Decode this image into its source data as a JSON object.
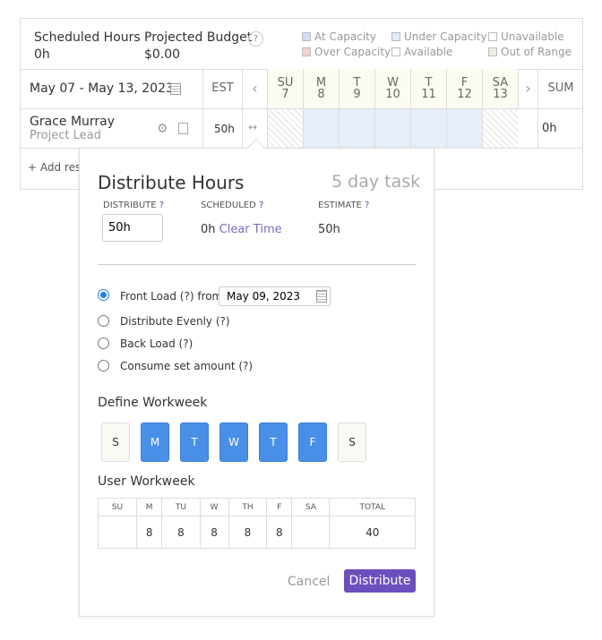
{
  "summary": {
    "scheduled_label": "Scheduled Hours",
    "scheduled_value": "0h",
    "budget_label": "Projected Budget",
    "budget_value": "$0.00",
    "help": "?"
  },
  "legend": [
    {
      "label": "At Capacity",
      "color": "#cfe0f7"
    },
    {
      "label": "Under Capacity",
      "color": "#e4ebfb"
    },
    {
      "label": "Unavailable",
      "color": "#ffffff"
    },
    {
      "label": "Over Capacity",
      "color": "#f4d3d0"
    },
    {
      "label": "Available",
      "color": "#ffffff"
    },
    {
      "label": "Out of Range",
      "color": "#eeeee6"
    }
  ],
  "header": {
    "date_range": "May 07 - May 13, 2023",
    "est": "EST",
    "sum": "SUM",
    "days": [
      {
        "d": "SU",
        "n": "7"
      },
      {
        "d": "M",
        "n": "8"
      },
      {
        "d": "T",
        "n": "9"
      },
      {
        "d": "W",
        "n": "10"
      },
      {
        "d": "T",
        "n": "11"
      },
      {
        "d": "F",
        "n": "12"
      },
      {
        "d": "SA",
        "n": "13"
      }
    ]
  },
  "row": {
    "name": "Grace Murray",
    "role": "Project Lead",
    "est": "50h",
    "sum": "0h"
  },
  "add_resource": "+ Add resource",
  "popover": {
    "title": "Distribute Hours",
    "task_length": "5 day task",
    "distribute_label": "DISTRIBUTE",
    "scheduled_label": "SCHEDULED",
    "estimate_label": "ESTIMATE",
    "q": "?",
    "distribute_value": "50h",
    "scheduled_value": "0h",
    "clear_time": "Clear Time",
    "estimate_value": "50h",
    "options": [
      "Front Load (?) from",
      "Distribute Evenly (?)",
      "Back Load (?)",
      "Consume set amount (?)"
    ],
    "selected_option": 0,
    "from_date": "May 09, 2023",
    "define_workweek": "Define Workweek",
    "workweek_days": [
      {
        "l": "S",
        "on": false
      },
      {
        "l": "M",
        "on": true
      },
      {
        "l": "T",
        "on": true
      },
      {
        "l": "W",
        "on": true
      },
      {
        "l": "T",
        "on": true
      },
      {
        "l": "F",
        "on": true
      },
      {
        "l": "S",
        "on": false
      }
    ],
    "user_workweek": "User Workweek",
    "ww_headers": [
      "SU",
      "M",
      "TU",
      "W",
      "TH",
      "F",
      "SA",
      "TOTAL"
    ],
    "ww_values": [
      "",
      "8",
      "8",
      "8",
      "8",
      "8",
      "",
      "40"
    ],
    "cancel": "Cancel",
    "distribute": "Distribute"
  }
}
